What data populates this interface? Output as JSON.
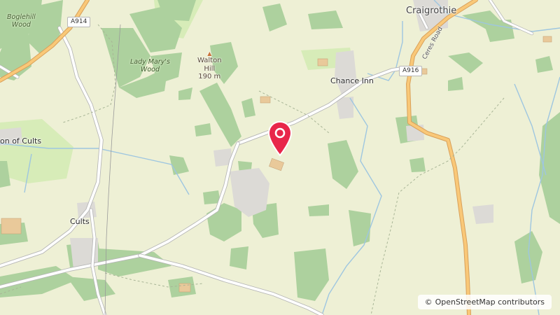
{
  "map": {
    "places": {
      "craigrothie": "Craigrothie",
      "chance_inn": "Chance Inn",
      "cults": "Cults",
      "pitlessie_of_cults": "on of Cults"
    },
    "woods": {
      "boglehill_line1": "Boglehill",
      "boglehill_line2": "Wood",
      "lady_marys_line1": "Lady Mary's",
      "lady_marys_line2": "Wood"
    },
    "peak": {
      "name_line1": "Walton",
      "name_line2": "Hill",
      "elevation": "190 m"
    },
    "roads": {
      "a914": "A914",
      "a916": "A916",
      "ceres_road": "Ceres Road"
    },
    "marker": {
      "color": "#e8264a"
    },
    "attribution": {
      "symbol": "©",
      "text": "OpenStreetMap contributors"
    }
  }
}
